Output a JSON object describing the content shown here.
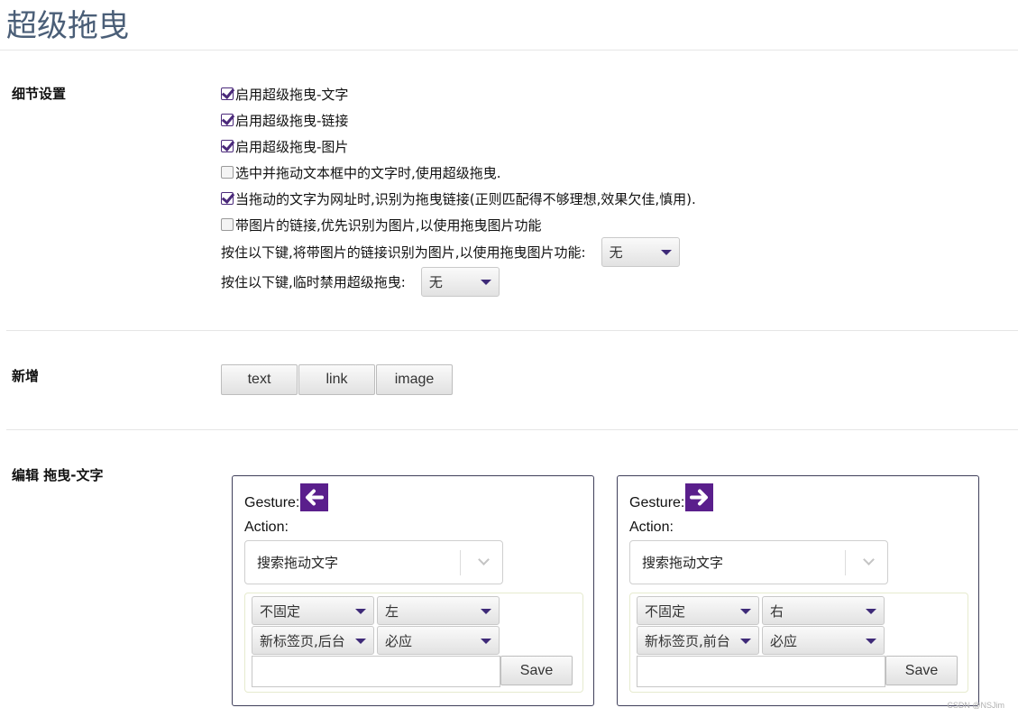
{
  "page": {
    "title": "超级拖曳"
  },
  "sections": {
    "details": {
      "label": "细节设置"
    },
    "add": {
      "label": "新增"
    },
    "edit": {
      "label": "编辑 拖曳-文字"
    }
  },
  "options": [
    {
      "label": "启用超级拖曳-文字",
      "checked": true
    },
    {
      "label": "启用超级拖曳-链接",
      "checked": true
    },
    {
      "label": "启用超级拖曳-图片",
      "checked": true
    },
    {
      "label": "选中并拖动文本框中的文字时,使用超级拖曳.",
      "checked": false
    },
    {
      "label": "当拖动的文字为网址时,识别为拖曳链接(正则匹配得不够理想,效果欠佳,慎用).",
      "checked": true
    },
    {
      "label": "带图片的链接,优先识别为图片,以使用拖曳图片功能",
      "checked": false
    }
  ],
  "key_settings": {
    "image_link": {
      "label": "按住以下键,将带图片的链接识别为图片,以使用拖曳图片功能:",
      "value": "无"
    },
    "disable": {
      "label": "按住以下键,临时禁用超级拖曳:",
      "value": "无"
    }
  },
  "add_buttons": {
    "text": "text",
    "link": "link",
    "image": "image"
  },
  "cards": [
    {
      "gesture_label": "Gesture:",
      "gesture_icon": "arrow-left-icon",
      "action_label": "Action:",
      "action_value": "搜索拖动文字",
      "sel1": "不固定",
      "sel2": "左",
      "sel3": "新标签页,后台",
      "sel4": "必应",
      "input_value": "",
      "save": "Save"
    },
    {
      "gesture_label": "Gesture:",
      "gesture_icon": "arrow-right-icon",
      "action_label": "Action:",
      "action_value": "搜索拖动文字",
      "sel1": "不固定",
      "sel2": "右",
      "sel3": "新标签页,前台",
      "sel4": "必应",
      "input_value": "",
      "save": "Save"
    }
  ],
  "colors": {
    "accent": "#5a1f8c",
    "title": "#4a5e77"
  },
  "watermark": "CSDN @NSJim"
}
